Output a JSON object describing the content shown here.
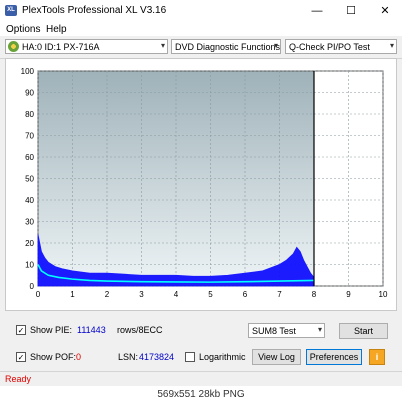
{
  "window": {
    "title": "PlexTools Professional XL V3.16",
    "icon": "XL",
    "minimize": "—",
    "maximize": "☐",
    "close": "✕"
  },
  "menu": {
    "items": [
      {
        "label": "Options"
      },
      {
        "label": "Help"
      }
    ]
  },
  "toolbar": {
    "drive": "HA:0 ID:1  PX-716A",
    "function": "DVD Diagnostic Functions",
    "test": "Q-Check PI/PO Test"
  },
  "chart_data": {
    "type": "area",
    "x_ticks": [
      "0",
      "1",
      "2",
      "3",
      "4",
      "5",
      "6",
      "7",
      "8",
      "9",
      "10"
    ],
    "y_ticks": [
      "0",
      "10",
      "20",
      "30",
      "40",
      "50",
      "60",
      "70",
      "80",
      "90",
      "100"
    ],
    "xlim": [
      0,
      10
    ],
    "ylim": [
      0,
      100
    ],
    "end_marker": 8,
    "grid": true,
    "series": [
      {
        "color": "#1010ff",
        "x": [
          0,
          0.05,
          0.1,
          0.2,
          0.3,
          0.4,
          0.5,
          0.7,
          1,
          1.5,
          2,
          2.5,
          3,
          3.5,
          4,
          4.5,
          5,
          5.5,
          6,
          6.5,
          7,
          7.2,
          7.4,
          7.5,
          7.6,
          7.7,
          7.8,
          7.9,
          8
        ],
        "y": [
          24,
          20,
          16,
          13,
          11,
          10,
          9,
          8,
          7,
          6,
          6,
          5.5,
          5,
          5,
          5,
          4.5,
          4.5,
          5,
          6,
          7,
          10,
          12,
          15,
          18,
          16,
          12,
          9,
          6,
          4
        ]
      },
      {
        "color": "#00ffff",
        "x": [
          0,
          0.1,
          0.3,
          0.6,
          1,
          1.5,
          2,
          3,
          4,
          5,
          6,
          7,
          8
        ],
        "y": [
          10,
          7,
          5,
          4,
          3.2,
          2.6,
          2.3,
          2.0,
          1.9,
          1.8,
          2.0,
          2.3,
          2.6
        ]
      }
    ]
  },
  "bottom": {
    "show_pie_label": "Show PIE:",
    "pie_value": "111443",
    "rows_label": "rows/8ECC",
    "show_pof_label": "Show POF:",
    "pof_value": "0",
    "lsn_label": "LSN:",
    "lsn_value": "4173824",
    "logarithmic_label": "Logarithmic",
    "sum_select": "SUM8 Test",
    "start_label": "Start",
    "view_log_label": "View Log",
    "preferences_label": "Preferences",
    "info_icon": "i",
    "checked_mark": "✓"
  },
  "status": {
    "text": "Ready"
  },
  "caption": {
    "text": "569x551  28kb  PNG"
  }
}
